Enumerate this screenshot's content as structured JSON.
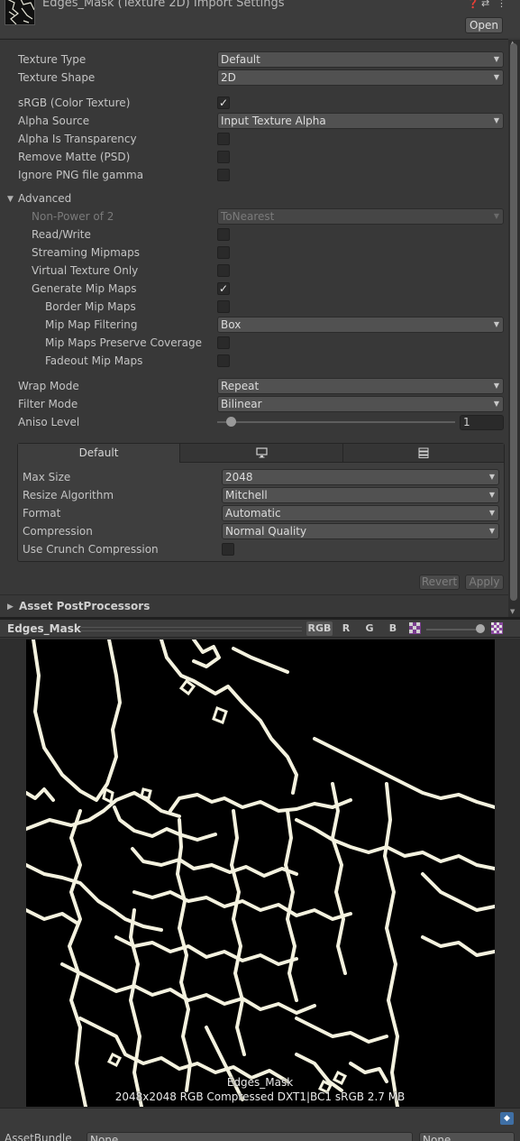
{
  "header": {
    "title": "Edges_Mask (Texture 2D) Import Settings",
    "open_label": "Open",
    "icons": [
      "help-icon",
      "settings-sliders-icon",
      "more-menu-icon"
    ]
  },
  "properties": {
    "texture_type": {
      "label": "Texture Type",
      "value": "Default"
    },
    "texture_shape": {
      "label": "Texture Shape",
      "value": "2D"
    },
    "srgb": {
      "label": "sRGB (Color Texture)",
      "checked": true
    },
    "alpha_source": {
      "label": "Alpha Source",
      "value": "Input Texture Alpha"
    },
    "alpha_is_transparency": {
      "label": "Alpha Is Transparency",
      "checked": false
    },
    "remove_matte": {
      "label": "Remove Matte (PSD)",
      "checked": false
    },
    "ignore_png_gamma": {
      "label": "Ignore PNG file gamma",
      "checked": false
    }
  },
  "advanced": {
    "label": "Advanced",
    "non_power_of_2": {
      "label": "Non-Power of 2",
      "value": "ToNearest"
    },
    "read_write": {
      "label": "Read/Write",
      "checked": false
    },
    "streaming_mipmaps": {
      "label": "Streaming Mipmaps",
      "checked": false
    },
    "virtual_texture_only": {
      "label": "Virtual Texture Only",
      "checked": false
    },
    "generate_mip_maps": {
      "label": "Generate Mip Maps",
      "checked": true
    },
    "border_mip_maps": {
      "label": "Border Mip Maps",
      "checked": false
    },
    "mip_map_filtering": {
      "label": "Mip Map Filtering",
      "value": "Box"
    },
    "mip_maps_preserve_coverage": {
      "label": "Mip Maps Preserve Coverage",
      "checked": false
    },
    "fadeout_mip_maps": {
      "label": "Fadeout Mip Maps",
      "checked": false
    }
  },
  "wrap_mode": {
    "label": "Wrap Mode",
    "value": "Repeat"
  },
  "filter_mode": {
    "label": "Filter Mode",
    "value": "Bilinear"
  },
  "aniso_level": {
    "label": "Aniso Level",
    "value": "1",
    "slider_fraction": 0.06
  },
  "platform": {
    "tabs": [
      {
        "label": "Default",
        "icon": ""
      },
      {
        "label": "",
        "icon": "monitor-icon"
      },
      {
        "label": "",
        "icon": "server-icon"
      }
    ],
    "max_size": {
      "label": "Max Size",
      "value": "2048"
    },
    "resize_algorithm": {
      "label": "Resize Algorithm",
      "value": "Mitchell"
    },
    "format": {
      "label": "Format",
      "value": "Automatic"
    },
    "compression": {
      "label": "Compression",
      "value": "Normal Quality"
    },
    "use_crunch": {
      "label": "Use Crunch Compression",
      "checked": false
    }
  },
  "buttons": {
    "revert": "Revert",
    "apply": "Apply"
  },
  "asset_postprocessors": {
    "label": "Asset PostProcessors"
  },
  "preview": {
    "title": "Edges_Mask",
    "channels": [
      "RGB",
      "R",
      "G",
      "B"
    ],
    "image_name": "Edges_Mask",
    "image_info": "2048x2048  RGB Compressed DXT1|BC1 sRGB   2.7 MB"
  },
  "asset_bundle": {
    "label": "AssetBundle",
    "value": "None",
    "variant": "None"
  }
}
